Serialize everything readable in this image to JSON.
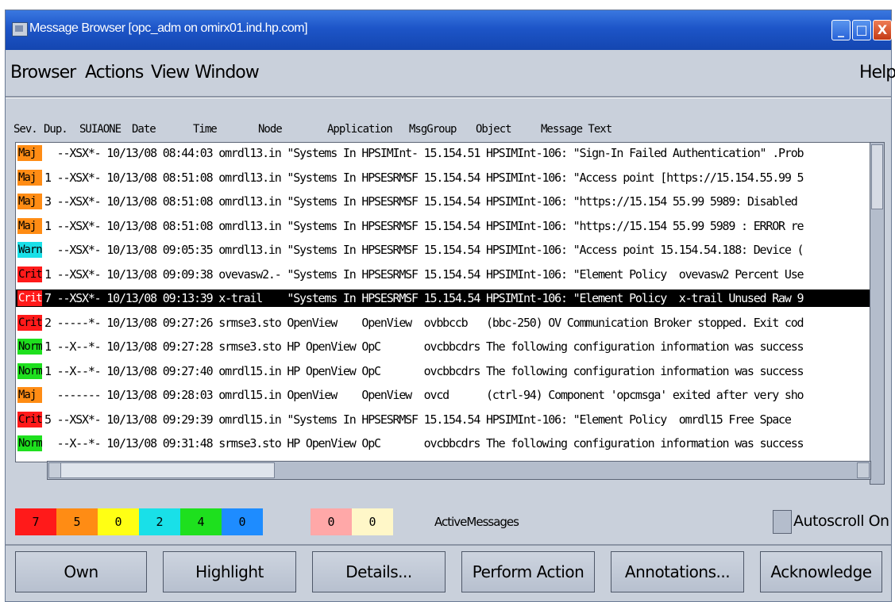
{
  "window": {
    "title": "Message Browser [opc_adm on omirx01.ind.hp.com]",
    "buttons": {
      "minimize": "_",
      "maximize": "□",
      "close": "X"
    }
  },
  "menubar": {
    "items": [
      {
        "label": "Browser"
      },
      {
        "label": "Actions"
      },
      {
        "label": "View"
      },
      {
        "label": "Window"
      }
    ],
    "help": "Help"
  },
  "columns": [
    "Sev.",
    "Dup.",
    "SUIAONE",
    "Date",
    "Time",
    "Node",
    "Application",
    "MsgGroup",
    "Object",
    "Message Text"
  ],
  "messages": [
    {
      "sev": "Maj",
      "color": "#ff8c14",
      "text": "  --XSX*- 10/13/08 08:44:03 omrdl13.in \"Systems In HPSIMInt- 15.154.51 HPSIMInt-106: \"Sign-In Failed Authentication\" .Prob"
    },
    {
      "sev": "Maj",
      "color": "#ff8c14",
      "text": "1 --XSX*- 10/13/08 08:51:08 omrdl13.in \"Systems In HPSESRMSF 15.154.54 HPSIMInt-106: \"Access point [https://15.154.55.99 5"
    },
    {
      "sev": "Maj",
      "color": "#ff8c14",
      "text": "3 --XSX*- 10/13/08 08:51:08 omrdl13.in \"Systems In HPSESRMSF 15.154.54 HPSIMInt-106: \"https://15.154 55.99 5989: Disabled"
    },
    {
      "sev": "Maj",
      "color": "#ff8c14",
      "text": "1 --XSX*- 10/13/08 08:51:08 omrdl13.in \"Systems In HPSESRMSF 15.154.54 HPSIMInt-106: \"https://15.154 55.99 5989 : ERROR re"
    },
    {
      "sev": "Warn",
      "color": "#19e0e8",
      "text": "  --XSX*- 10/13/08 09:05:35 omrdl13.in \"Systems In HPSESRMSF 15.154.54 HPSIMInt-106: \"Access point 15.154.54.188: Device ("
    },
    {
      "sev": "Crit",
      "color": "#ff1a1a",
      "text": "1 --XSX*- 10/13/08 09:09:38 ovevasw2.- \"Systems In HPSESRMSF 15.154.54 HPSIMInt-106: \"Element Policy  ovevasw2 Percent Use"
    },
    {
      "sev": "Crit",
      "color": "#ff1a1a",
      "text": "7 --XSX*- 10/13/08 09:13:39 x-trail    \"Systems In HPSESRMSF 15.154.54 HPSIMInt-106: \"Element Policy  x-trail Unused Raw 9",
      "selected": true
    },
    {
      "sev": "Crit",
      "color": "#ff1a1a",
      "text": "2 -----*- 10/13/08 09:27:26 srmse3.sto OpenView    OpenView  ovbbccb   (bbc-250) OV Communication Broker stopped. Exit cod"
    },
    {
      "sev": "Norm",
      "color": "#1ee01e",
      "text": "1 --X--*- 10/13/08 09:27:28 srmse3.sto HP OpenView OpC       ovcbbcdrs The following configuration information was success"
    },
    {
      "sev": "Norm",
      "color": "#1ee01e",
      "text": "1 --X--*- 10/13/08 09:27:40 omrdl15.in HP OpenView OpC       ovcbbcdrs The following configuration information was success"
    },
    {
      "sev": "Maj",
      "color": "#ff8c14",
      "text": "  ------- 10/13/08 09:28:03 omrdl15.in OpenView    OpenView  ovcd      (ctrl-94) Component 'opcmsga' exited after very sho"
    },
    {
      "sev": "Crit",
      "color": "#ff1a1a",
      "text": "5 --XSX*- 10/13/08 09:29:39 omrdl15.in \"Systems In HPSESRMSF 15.154.54 HPSIMInt-106: \"Element Policy  omrdl15 Free Space"
    },
    {
      "sev": "Norm",
      "color": "#1ee01e",
      "text": "  --X--*- 10/13/08 09:31:48 srmse3.sto HP OpenView OpC       ovcbbcdrs The following configuration information was success"
    }
  ],
  "severity_counts": [
    {
      "label": "7",
      "color": "#ff1a1a"
    },
    {
      "label": "5",
      "color": "#ff8c14"
    },
    {
      "label": "0",
      "color": "#ffff14"
    },
    {
      "label": "2",
      "color": "#19e0e8"
    },
    {
      "label": "4",
      "color": "#1ee01e"
    },
    {
      "label": "0",
      "color": "#1e8cff"
    },
    {
      "label": "0",
      "color": "#ffa8a8"
    },
    {
      "label": "0",
      "color": "#fff7c8"
    }
  ],
  "active_messages_label": "ActiveMessages",
  "autoscroll_label": "Autoscroll On",
  "buttons": [
    "Own",
    "Highlight",
    "Details...",
    "Perform Action",
    "Annotations...",
    "Acknowledge"
  ]
}
